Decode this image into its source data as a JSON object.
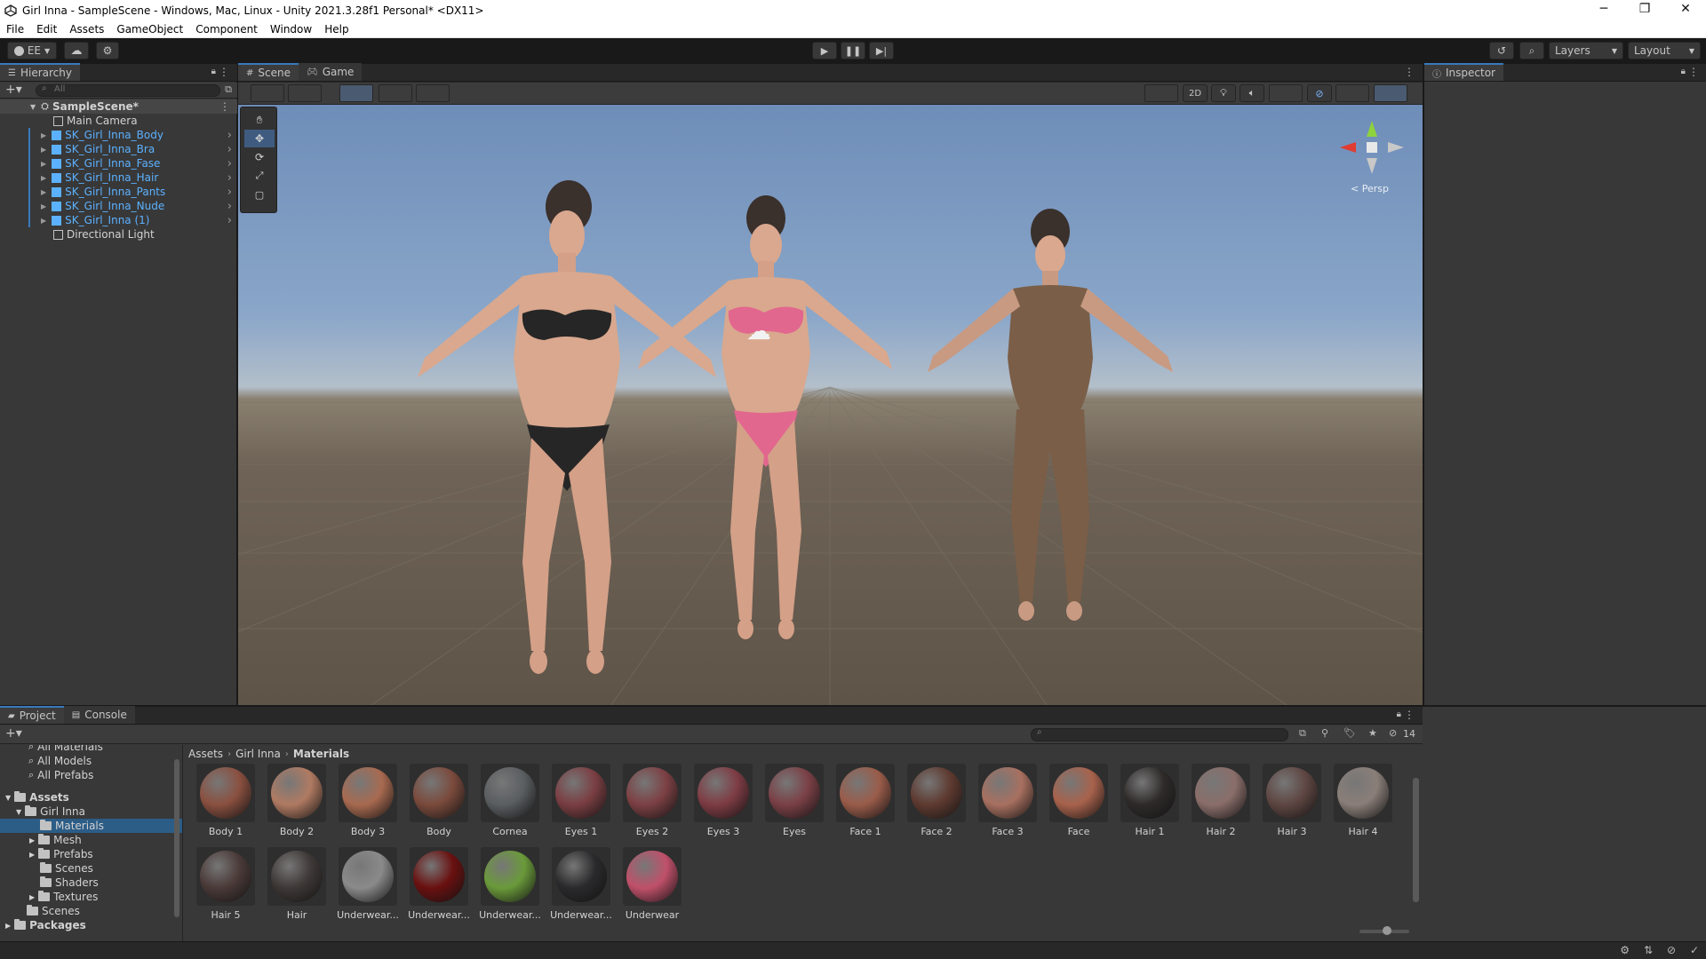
{
  "window": {
    "title": "Girl Inna - SampleScene - Windows, Mac, Linux - Unity 2021.3.28f1 Personal* <DX11>",
    "controls": [
      "─",
      "❐",
      "✕"
    ]
  },
  "menu": [
    "File",
    "Edit",
    "Assets",
    "GameObject",
    "Component",
    "Window",
    "Help"
  ],
  "toolbar": {
    "account_label": "EE",
    "layers_label": "Layers",
    "layout_label": "Layout"
  },
  "hierarchy": {
    "tab_label": "Hierarchy",
    "search_placeholder": "All",
    "scene_name": "SampleScene*",
    "items": [
      {
        "label": "Main Camera",
        "prefab": false
      },
      {
        "label": "SK_Girl_Inna_Body",
        "prefab": true
      },
      {
        "label": "SK_Girl_Inna_Bra",
        "prefab": true
      },
      {
        "label": "SK_Girl_Inna_Fase",
        "prefab": true
      },
      {
        "label": "SK_Girl_Inna_Hair",
        "prefab": true
      },
      {
        "label": "SK_Girl_Inna_Pants",
        "prefab": true
      },
      {
        "label": "SK_Girl_Inna_Nude",
        "prefab": true
      },
      {
        "label": "SK_Girl_Inna (1)",
        "prefab": true
      },
      {
        "label": "Directional Light",
        "prefab": false
      }
    ]
  },
  "scene": {
    "tabs": [
      "Scene",
      "Game"
    ],
    "mode_2d_label": "2D",
    "persp_label": "< Persp"
  },
  "inspector": {
    "tab_label": "Inspector"
  },
  "project": {
    "tabs": [
      "Project",
      "Console"
    ],
    "favorites": [
      "All Materials",
      "All Models",
      "All Prefabs"
    ],
    "tree": {
      "assets_label": "Assets",
      "girl_inna": "Girl Inna",
      "children": [
        "Materials",
        "Mesh",
        "Prefabs",
        "Scenes",
        "Shaders",
        "Textures"
      ],
      "scenes_label": "Scenes",
      "packages_label": "Packages"
    },
    "breadcrumb": [
      "Assets",
      "Girl Inna",
      "Materials"
    ],
    "hidden_count": "14",
    "materials": [
      {
        "label": "Body 1",
        "color": "#8a5040"
      },
      {
        "label": "Body 2",
        "color": "#b07a62"
      },
      {
        "label": "Body 3",
        "color": "#a86a50"
      },
      {
        "label": "Body",
        "color": "#7a4a3c"
      },
      {
        "label": "Cornea",
        "color": "#5a5e60"
      },
      {
        "label": "Eyes 1",
        "color": "#7a3e42"
      },
      {
        "label": "Eyes 2",
        "color": "#7c4044"
      },
      {
        "label": "Eyes 3",
        "color": "#7e3c44"
      },
      {
        "label": "Eyes",
        "color": "#7a4046"
      },
      {
        "label": "Face 1",
        "color": "#9a5c4a"
      },
      {
        "label": "Face 2",
        "color": "#5e3a30"
      },
      {
        "label": "Face 3",
        "color": "#a87060"
      },
      {
        "label": "Face",
        "color": "#a8624c"
      },
      {
        "label": "Hair 1",
        "color": "#2e2a2a"
      },
      {
        "label": "Hair 2",
        "color": "#8a6e6a"
      },
      {
        "label": "Hair 3",
        "color": "#5e4642"
      },
      {
        "label": "Hair 4",
        "color": "#8a7e78"
      },
      {
        "label": "Hair 5",
        "color": "#4a3a38"
      },
      {
        "label": "Hair",
        "color": "#3e3836"
      },
      {
        "label": "Underwear...",
        "color": "#8a8a8a"
      },
      {
        "label": "Underwear...",
        "color": "#6a1010"
      },
      {
        "label": "Underwear...",
        "color": "#6a9a3a"
      },
      {
        "label": "Underwear...",
        "color": "#2a2a2c"
      },
      {
        "label": "Underwear",
        "color": "#c0506a"
      }
    ]
  }
}
